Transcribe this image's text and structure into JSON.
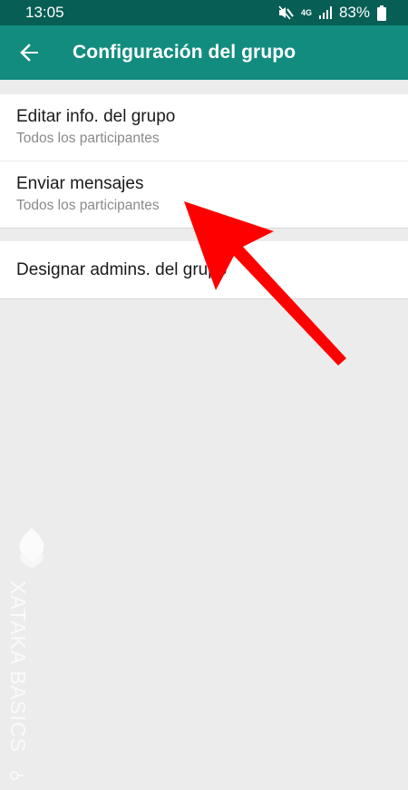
{
  "status_bar": {
    "time": "13:05",
    "network": "4G",
    "battery": "83%",
    "icons": [
      "mute-icon",
      "network-4g-icon",
      "signal-icon",
      "battery-icon"
    ]
  },
  "app_bar": {
    "title": "Configuración del grupo",
    "back_icon": "arrow-back-icon"
  },
  "settings": {
    "items": [
      {
        "title": "Editar info. del grupo",
        "subtitle": "Todos los participantes"
      },
      {
        "title": "Enviar mensajes",
        "subtitle": "Todos los participantes"
      },
      {
        "title": "Designar admins. del grupo"
      }
    ]
  },
  "watermark": {
    "text": "XATAKA BASICS"
  },
  "colors": {
    "status_bar": "#075e54",
    "app_bar": "#128c7e",
    "annotation_arrow": "#ff0000",
    "background": "#ececec"
  }
}
